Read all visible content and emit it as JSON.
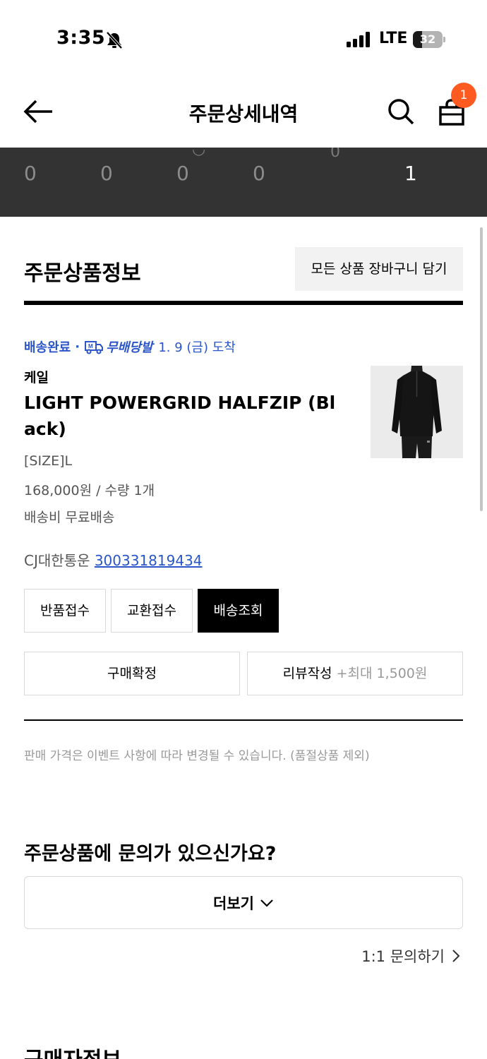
{
  "status_bar": {
    "time": "3:35",
    "network": "LTE",
    "battery": "32",
    "battery_level": 0.32
  },
  "header": {
    "title": "주문상세내역",
    "cart_badge": "1"
  },
  "order_steps": {
    "counts": [
      "0",
      "0",
      "0",
      "0",
      "1"
    ]
  },
  "order_section": {
    "title": "주문상품정보",
    "add_all_to_cart": "모든 상품 장바구니 담기"
  },
  "item": {
    "delivery_status": "배송완료",
    "free_delivery_badge": "무배당발",
    "arrival": "1. 9 (금) 도착",
    "brand": "케일",
    "name": "LIGHT POWERGRID HALFZIP (Black)",
    "size": "[SIZE]L",
    "price_qty": "168,000원 / 수량 1개",
    "shipping_fee": "배송비 무료배송",
    "courier": "CJ대한통운",
    "tracking_number": "300331819434"
  },
  "actions": {
    "return": "반품접수",
    "exchange": "교환접수",
    "track": "배송조회",
    "confirm": "구매확정",
    "review": "리뷰작성",
    "review_reward": "+최대 1,500원"
  },
  "notice": "판매 가격은 이벤트 사항에 따라 변경될 수 있습니다. (품절상품 제외)",
  "inquiry": {
    "title": "주문상품에 문의가 있으신가요?",
    "more": "더보기",
    "one_to_one": "1:1 문의하기"
  },
  "buyer_section": {
    "title": "구매자정보"
  }
}
